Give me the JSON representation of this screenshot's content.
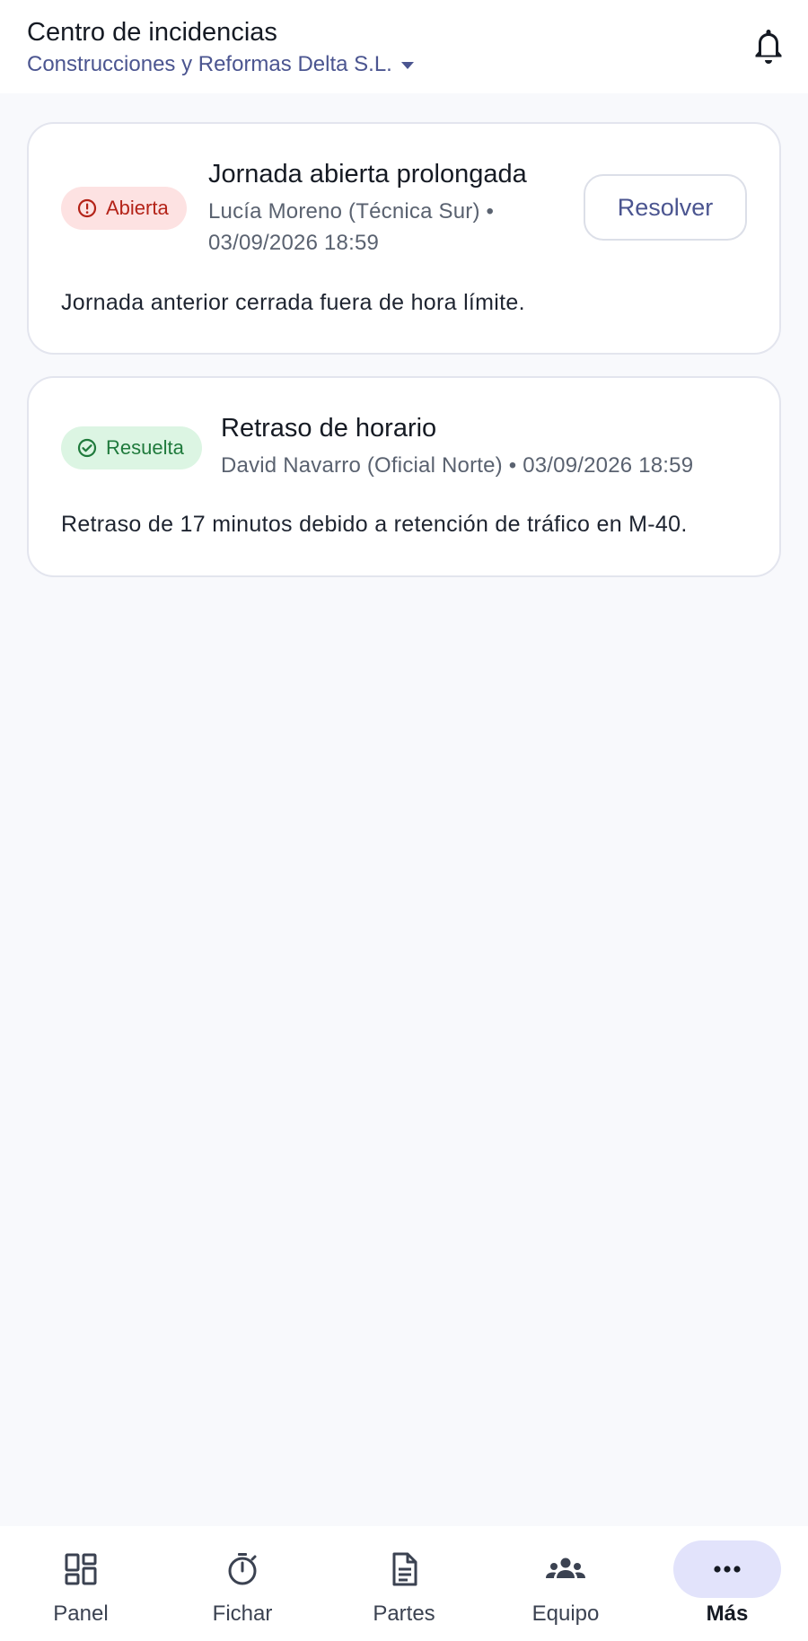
{
  "header": {
    "title": "Centro de incidencias",
    "company": "Construcciones y Reformas Delta S.L."
  },
  "incidents": [
    {
      "status": "Abierta",
      "title": "Jornada abierta prolongada",
      "meta_line1": "Lucía Moreno (Técnica Sur) •",
      "meta_line2": "03/09/2026 18:59",
      "description": "Jornada anterior cerrada fuera de hora límite.",
      "action": "Resolver"
    },
    {
      "status": "Resuelta",
      "title": "Retraso de horario",
      "meta": "David Navarro (Oficial Norte) • 03/09/2026 18:59",
      "description": "Retraso de 17 minutos debido a retención de tráfico en M-40."
    }
  ],
  "nav": [
    {
      "label": "Panel",
      "icon": "dashboard-icon"
    },
    {
      "label": "Fichar",
      "icon": "timer-icon"
    },
    {
      "label": "Partes",
      "icon": "document-icon"
    },
    {
      "label": "Equipo",
      "icon": "group-icon"
    },
    {
      "label": "Más",
      "icon": "more-icon",
      "active": true
    }
  ],
  "colors": {
    "accent": "#4b5590",
    "open_bg": "#fde2e2",
    "open_fg": "#b42318",
    "resolved_bg": "#dcf5e3",
    "resolved_fg": "#1f7a3c",
    "active_nav_bg": "#e2e3fb"
  }
}
